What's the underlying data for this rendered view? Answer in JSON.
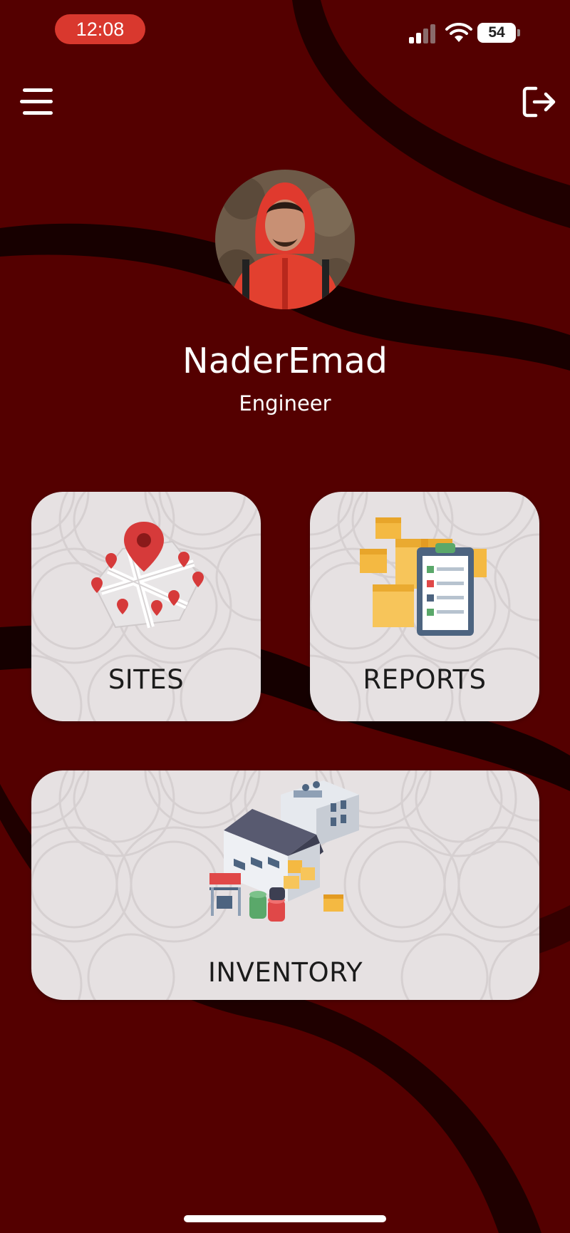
{
  "status_bar": {
    "time": "12:08",
    "battery": "54",
    "icons": [
      "signal-icon",
      "wifi-icon",
      "battery-icon"
    ]
  },
  "header": {
    "menu_icon": "hamburger-menu-icon",
    "logout_icon": "logout-icon"
  },
  "profile": {
    "name": "NaderEmad",
    "role": "Engineer"
  },
  "cards": {
    "sites": {
      "label": "SITES",
      "icon": "map-pins-icon"
    },
    "reports": {
      "label": "REPORTS",
      "icon": "boxes-clipboard-icon"
    },
    "inventory": {
      "label": "INVENTORY",
      "icon": "warehouse-icon"
    }
  },
  "colors": {
    "background": "#540000",
    "card": "#e6e1e2",
    "time_pill": "#d9382e",
    "accent_red": "#d63a3a"
  }
}
